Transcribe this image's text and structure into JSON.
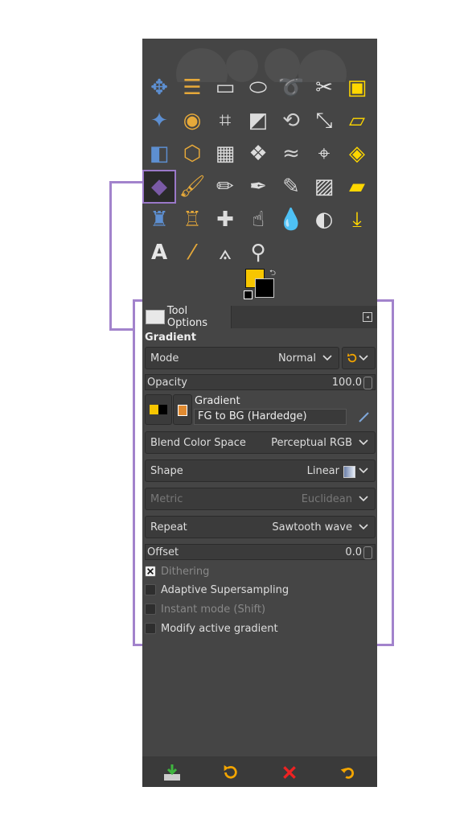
{
  "tool_options": {
    "tab_label": "Tool Options",
    "title": "Gradient",
    "mode": {
      "label": "Mode",
      "value": "Normal"
    },
    "opacity": {
      "label": "Opacity",
      "value": "100.0"
    },
    "gradient": {
      "label": "Gradient",
      "value": "FG to BG (Hardedge)"
    },
    "blend_color_space": {
      "label": "Blend Color Space",
      "value": "Perceptual RGB"
    },
    "shape": {
      "label": "Shape",
      "value": "Linear"
    },
    "metric": {
      "label": "Metric",
      "value": "Euclidean"
    },
    "repeat": {
      "label": "Repeat",
      "value": "Sawtooth wave"
    },
    "offset": {
      "label": "Offset",
      "value": "0.0"
    },
    "checkboxes": [
      {
        "label": "Dithering",
        "checked": true
      },
      {
        "label": "Adaptive Supersampling",
        "checked": false
      },
      {
        "label": "Instant mode  (Shift)",
        "checked": false
      },
      {
        "label": "Modify active gradient",
        "checked": false
      }
    ]
  },
  "colors": {
    "fg": "#f7c600",
    "bg": "#000000",
    "panel": "#454545",
    "highlight": "#a283cc"
  },
  "icons": [
    "move-icon",
    "align-icon",
    "rect-select-icon",
    "ellipse-select-icon",
    "lasso-icon",
    "scissors-select-icon",
    "foreground-select-icon",
    "fuzzy-select-icon",
    "color-select-icon",
    "crop-icon",
    "unified-transform-icon",
    "rotate-icon",
    "scale-icon",
    "shear-icon",
    "flip-icon",
    "perspective-icon",
    "cage-transform-icon",
    "warp-transform-icon",
    "seamless-clone-icon",
    "handle-transform-icon",
    "gegl-icon",
    "gradient-icon",
    "paintbrush-icon",
    "pencil-icon",
    "airbrush-icon",
    "ink-icon",
    "mypaint-brush-icon",
    "eraser-icon",
    "clone-icon",
    "perspective-clone-icon",
    "heal-icon",
    "smudge-icon",
    "blur-icon",
    "dodge-burn-icon",
    "paths-icon",
    "text-icon",
    "color-picker-icon",
    "measure-icon",
    "zoom-icon"
  ]
}
